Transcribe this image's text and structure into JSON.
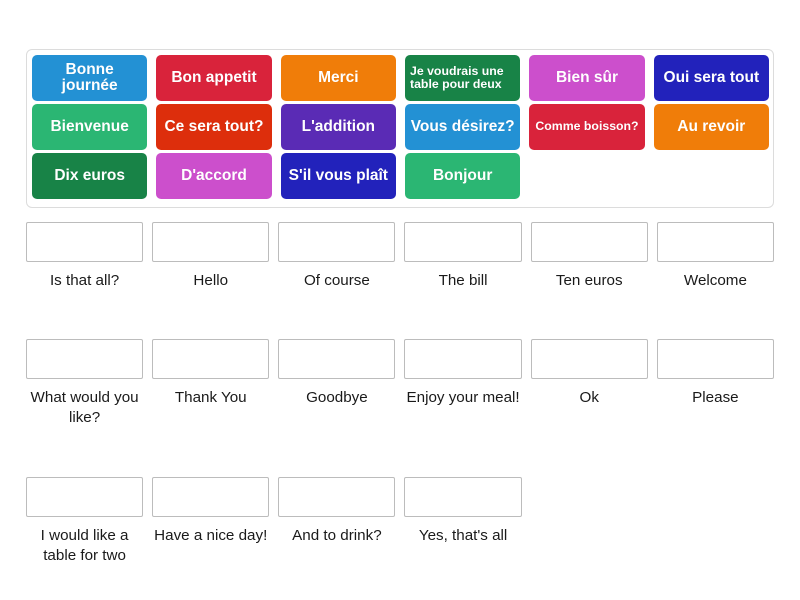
{
  "activity": {
    "type": "match-up-drag-and-drop",
    "background_color": "#ffffff"
  },
  "palette": {
    "light_blue": "#2391d4",
    "green": "#2bb673",
    "dark_green": "#188347",
    "crimson": "#d9233b",
    "orange_red": "#dd2e0c",
    "orchid": "#cc4fcc",
    "orange": "#f07d09",
    "purple": "#5a2bb5",
    "deep_blue": "#2222bb",
    "box_border": "#bcbcbc",
    "bank_border": "#dcdcdc",
    "label_text": "#1a1a1a",
    "tile_text": "#ffffff"
  },
  "tile_bank": {
    "name": "draggable-french-phrases",
    "tiles": [
      {
        "label": "Bonne journée",
        "color": "#2391d4",
        "size": "normal",
        "align": "center"
      },
      {
        "label": "Bon appetit",
        "color": "#d9233b",
        "size": "normal",
        "align": "center"
      },
      {
        "label": "Merci",
        "color": "#f07d09",
        "size": "normal",
        "align": "center"
      },
      {
        "label": "Je voudrais une table pour deux",
        "color": "#188347",
        "size": "small",
        "align": "left"
      },
      {
        "label": "Bien sûr",
        "color": "#cc4fcc",
        "size": "normal",
        "align": "center"
      },
      {
        "label": "Oui sera tout",
        "color": "#2222bb",
        "size": "normal",
        "align": "center"
      },
      {
        "label": "Bienvenue",
        "color": "#2bb673",
        "size": "normal",
        "align": "center"
      },
      {
        "label": "Ce sera tout?",
        "color": "#dd2e0c",
        "size": "normal",
        "align": "center"
      },
      {
        "label": "L'addition",
        "color": "#5a2bb5",
        "size": "normal",
        "align": "center"
      },
      {
        "label": "Vous désirez?",
        "color": "#2391d4",
        "size": "normal",
        "align": "center"
      },
      {
        "label": "Comme boisson?",
        "color": "#d9233b",
        "size": "small",
        "align": "center"
      },
      {
        "label": "Au revoir",
        "color": "#f07d09",
        "size": "normal",
        "align": "center"
      },
      {
        "label": "Dix euros",
        "color": "#188347",
        "size": "normal",
        "align": "center"
      },
      {
        "label": "D'accord",
        "color": "#cc4fcc",
        "size": "normal",
        "align": "center"
      },
      {
        "label": "S'il vous plaît",
        "color": "#2222bb",
        "size": "normal",
        "align": "center"
      },
      {
        "label": "Bonjour",
        "color": "#2bb673",
        "size": "normal",
        "align": "center"
      },
      {
        "label": "",
        "color": "transparent",
        "size": "normal",
        "align": "center"
      },
      {
        "label": "",
        "color": "transparent",
        "size": "normal",
        "align": "center"
      }
    ]
  },
  "answer_rows": [
    {
      "cells": [
        {
          "label": "Is that all?",
          "value": ""
        },
        {
          "label": "Hello",
          "value": ""
        },
        {
          "label": "Of course",
          "value": ""
        },
        {
          "label": "The bill",
          "value": ""
        },
        {
          "label": "Ten euros",
          "value": ""
        },
        {
          "label": "Welcome",
          "value": ""
        }
      ]
    },
    {
      "cells": [
        {
          "label": "What would you like?",
          "value": ""
        },
        {
          "label": "Thank You",
          "value": ""
        },
        {
          "label": "Goodbye",
          "value": ""
        },
        {
          "label": "Enjoy your meal!",
          "value": ""
        },
        {
          "label": "Ok",
          "value": ""
        },
        {
          "label": "Please",
          "value": ""
        }
      ]
    },
    {
      "cells": [
        {
          "label": "I would like a table for two",
          "value": ""
        },
        {
          "label": "Have a nice day!",
          "value": ""
        },
        {
          "label": "And to drink?",
          "value": ""
        },
        {
          "label": "Yes, that's all",
          "value": ""
        },
        {
          "label": "",
          "value": "",
          "blank": true
        },
        {
          "label": "",
          "value": "",
          "blank": true
        }
      ]
    }
  ]
}
